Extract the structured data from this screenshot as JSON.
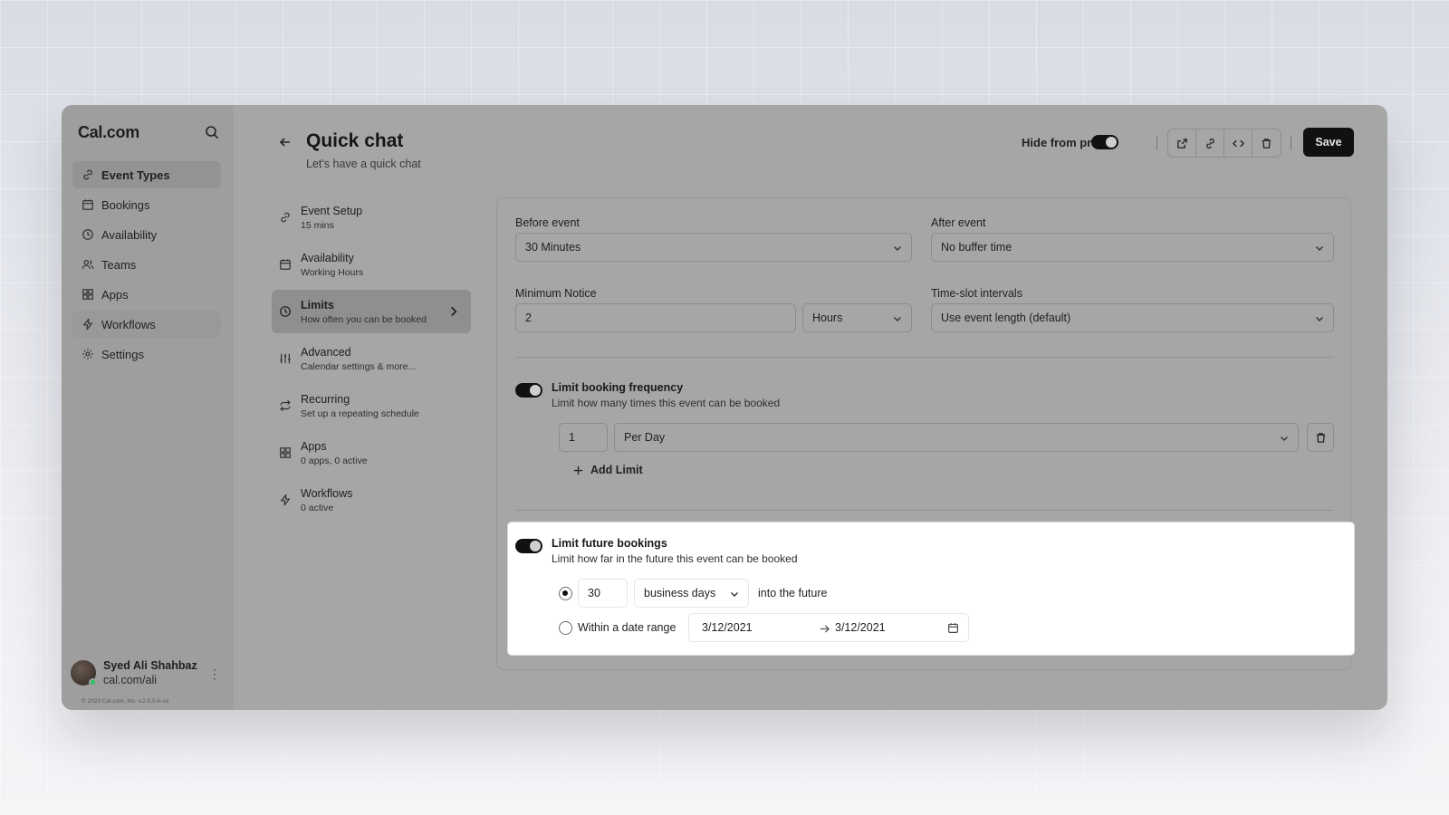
{
  "sidebar": {
    "brand": "Cal.com",
    "items": [
      {
        "label": "Event Types",
        "icon": "link-icon"
      },
      {
        "label": "Bookings",
        "icon": "calendar-icon"
      },
      {
        "label": "Availability",
        "icon": "clock-icon"
      },
      {
        "label": "Teams",
        "icon": "users-icon"
      },
      {
        "label": "Apps",
        "icon": "grid-icon"
      },
      {
        "label": "Workflows",
        "icon": "zap-icon"
      },
      {
        "label": "Settings",
        "icon": "gear-icon"
      }
    ],
    "user": {
      "name": "Syed Ali Shahbaz",
      "handle": "cal.com/ali"
    },
    "copyright": "© 2023 Cal.com, Inc. v.2.5.5-h-ce"
  },
  "header": {
    "title": "Quick chat",
    "subtitle": "Let's have a quick chat",
    "hide_from_profile": "Hide from profile",
    "save": "Save"
  },
  "subnav": [
    {
      "title": "Event Setup",
      "desc": "15 mins"
    },
    {
      "title": "Availability",
      "desc": "Working Hours"
    },
    {
      "title": "Limits",
      "desc": "How often you can be booked"
    },
    {
      "title": "Advanced",
      "desc": "Calendar settings & more..."
    },
    {
      "title": "Recurring",
      "desc": "Set up a repeating schedule"
    },
    {
      "title": "Apps",
      "desc": "0 apps, 0 active"
    },
    {
      "title": "Workflows",
      "desc": "0 active"
    }
  ],
  "limits": {
    "before_event": {
      "label": "Before event",
      "value": "30 Minutes"
    },
    "after_event": {
      "label": "After event",
      "value": "No buffer time"
    },
    "min_notice": {
      "label": "Minimum Notice",
      "value": "2",
      "unit": "Hours"
    },
    "time_slot": {
      "label": "Time-slot intervals",
      "value": "Use event length (default)"
    },
    "frequency": {
      "title": "Limit booking frequency",
      "desc": "Limit how many times this event can be booked",
      "count": "1",
      "period": "Per Day",
      "add": "Add Limit"
    },
    "future": {
      "title": "Limit future bookings",
      "desc": "Limit how far in the future this event can be booked",
      "days": "30",
      "days_unit": "business days",
      "into_future": "into the future",
      "range_label": "Within a date range",
      "start": "3/12/2021",
      "end": "3/12/2021"
    }
  }
}
